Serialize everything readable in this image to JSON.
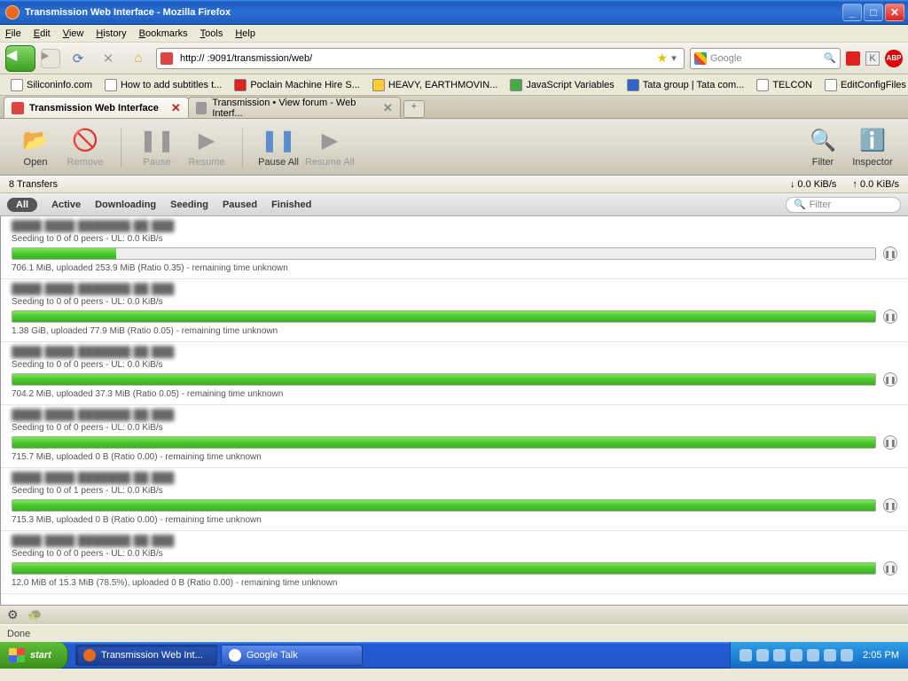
{
  "window": {
    "title": "Transmission Web Interface - Mozilla Firefox"
  },
  "menu": [
    "File",
    "Edit",
    "View",
    "History",
    "Bookmarks",
    "Tools",
    "Help"
  ],
  "url": "http://            :9091/transmission/web/",
  "search_placeholder": "Google",
  "bookmarks": [
    {
      "label": "Siliconinfo.com"
    },
    {
      "label": "How to add subtitles t..."
    },
    {
      "label": "Poclain Machine Hire S..."
    },
    {
      "label": "HEAVY, EARTHMOVIN..."
    },
    {
      "label": "JavaScript Variables"
    },
    {
      "label": "Tata group | Tata com..."
    },
    {
      "label": "TELCON"
    },
    {
      "label": "EditConfigFiles – Tran..."
    }
  ],
  "tabs": [
    {
      "label": "Transmission Web Interface",
      "active": true
    },
    {
      "label": "Transmission • View forum - Web Interf...",
      "active": false
    }
  ],
  "toolbar": {
    "open": "Open",
    "remove": "Remove",
    "pause": "Pause",
    "resume": "Resume",
    "pause_all": "Pause All",
    "resume_all": "Resume All",
    "filter": "Filter",
    "inspector": "Inspector"
  },
  "status": {
    "count": "8 Transfers",
    "down": "↓ 0.0 KiB/s",
    "up": "↑ 0.0 KiB/s"
  },
  "filters": {
    "all": "All",
    "active": "Active",
    "downloading": "Downloading",
    "seeding": "Seeding",
    "paused": "Paused",
    "finished": "Finished",
    "box_placeholder": "Filter"
  },
  "torrents": [
    {
      "peers": "Seeding to 0 of 0 peers - UL: 0.0 KiB/s",
      "pct": 12,
      "meta": "706.1 MiB, uploaded 253.9 MiB (Ratio 0.35) - remaining time unknown"
    },
    {
      "peers": "Seeding to 0 of 0 peers - UL: 0.0 KiB/s",
      "pct": 100,
      "meta": "1.38 GiB, uploaded 77.9 MiB (Ratio 0.05) - remaining time unknown"
    },
    {
      "peers": "Seeding to 0 of 0 peers - UL: 0.0 KiB/s",
      "pct": 100,
      "meta": "704.2 MiB, uploaded 37.3 MiB (Ratio 0.05) - remaining time unknown"
    },
    {
      "peers": "Seeding to 0 of 0 peers - UL: 0.0 KiB/s",
      "pct": 100,
      "meta": "715.7 MiB, uploaded 0 B (Ratio 0.00) - remaining time unknown"
    },
    {
      "peers": "Seeding to 0 of 1 peers - UL: 0.0 KiB/s",
      "pct": 100,
      "meta": "715.3 MiB, uploaded 0 B (Ratio 0.00) - remaining time unknown"
    },
    {
      "peers": "Seeding to 0 of 0 peers - UL: 0.0 KiB/s",
      "pct": 100,
      "meta": "12.0 MiB of 15.3 MiB (78.5%), uploaded 0 B (Ratio 0.00) - remaining time unknown"
    }
  ],
  "bottom": {
    "gear": "⚙",
    "turtle": "🐢"
  },
  "statusbar": "Done",
  "taskbar": {
    "start": "start",
    "tasks": [
      {
        "label": "Transmission Web Int...",
        "active": true,
        "color": "#e66a1f"
      },
      {
        "label": "Google Talk",
        "active": false,
        "color": "#fff"
      }
    ],
    "clock": "2:05 PM"
  }
}
